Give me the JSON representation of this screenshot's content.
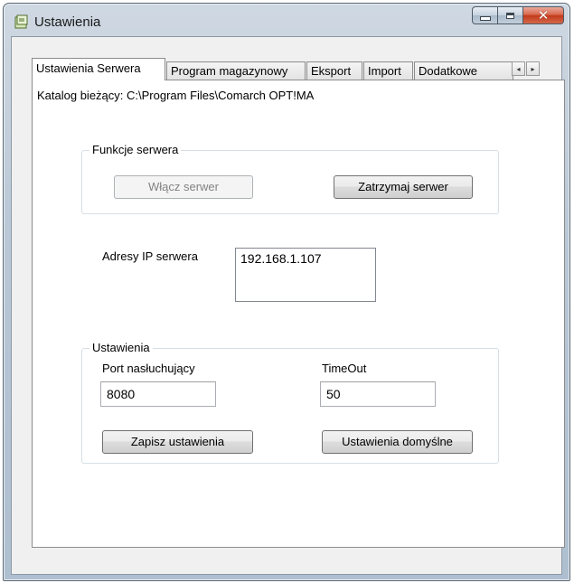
{
  "window": {
    "title": "Ustawienia",
    "close_glyph": "✕"
  },
  "tabs": [
    {
      "label": "Ustawienia Serwera",
      "active": true
    },
    {
      "label": "Program magazynowy",
      "active": false
    },
    {
      "label": "Eksport",
      "active": false
    },
    {
      "label": "Import",
      "active": false
    },
    {
      "label": "Dodatkowe",
      "active": false
    }
  ],
  "tab_scroll": {
    "left": "◂",
    "right": "▸"
  },
  "server_tab": {
    "catalog_label": "Katalog bieżący: C:\\Program Files\\Comarch OPT!MA",
    "server_functions": {
      "title": "Funkcje serwera",
      "start_label": "Włącz serwer",
      "stop_label": "Zatrzymaj serwer"
    },
    "ip": {
      "label": "Adresy IP serwera",
      "addresses": [
        "192.168.1.107"
      ]
    },
    "settings": {
      "title": "Ustawienia",
      "port_label": "Port nasłuchujący",
      "port_value": "8080",
      "timeout_label": "TimeOut",
      "timeout_value": "50",
      "save_label": "Zapisz ustawienia",
      "defaults_label": "Ustawienia domyślne"
    }
  },
  "icons": {
    "app": "app-settings-icon",
    "minimize": "minimize-icon",
    "maximize": "maximize-icon",
    "close": "close-icon"
  }
}
